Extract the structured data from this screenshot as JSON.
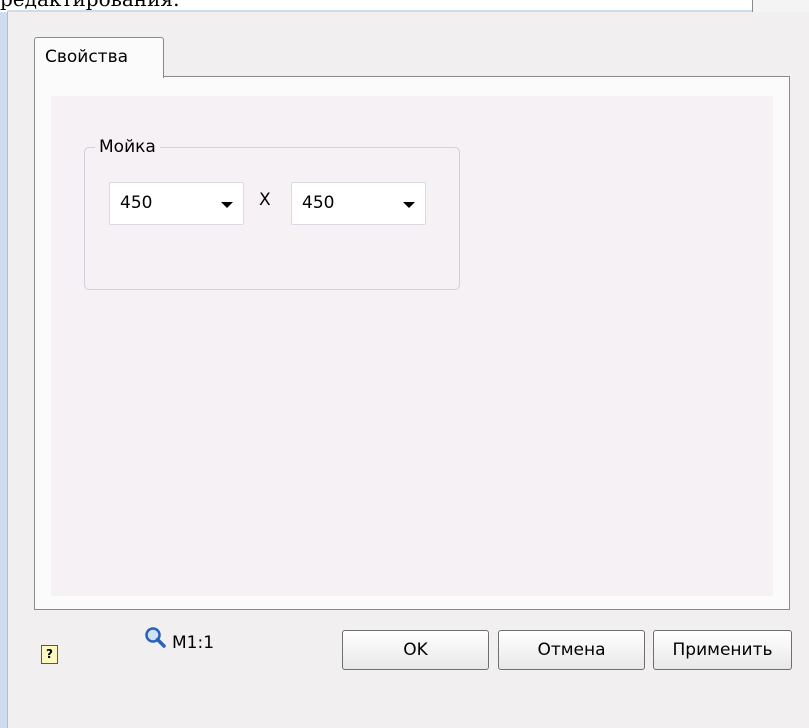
{
  "page": {
    "top_text": "редактирования."
  },
  "tabs": [
    {
      "label": "Свойства",
      "active": true
    }
  ],
  "group": {
    "label": "Мойка",
    "width_value": "450",
    "separator": "X",
    "height_value": "450"
  },
  "footer": {
    "help_glyph": "?",
    "scale_label": "M1:1",
    "ok_label": "OK",
    "cancel_label": "Отмена",
    "apply_label": "Применить"
  },
  "colors": {
    "frame_accent": "#cfdcee",
    "panel_bg": "#f5f1f4",
    "dialog_bg": "#f1eff0"
  }
}
